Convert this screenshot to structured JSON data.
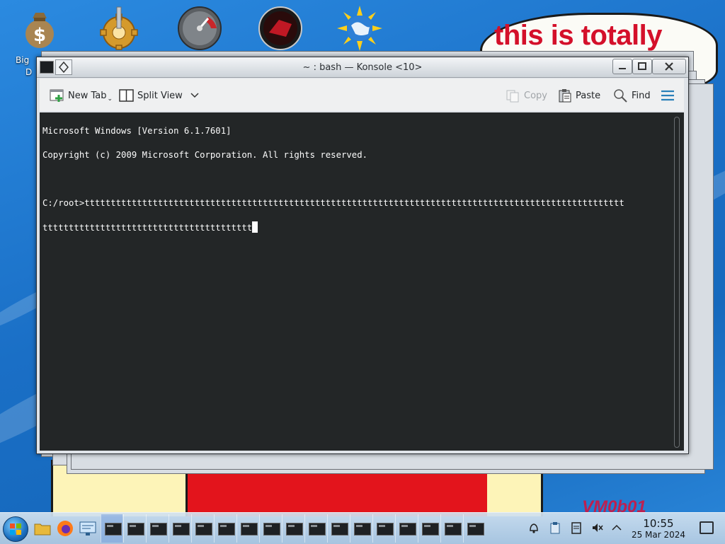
{
  "desktop": {
    "icon_label_line1": "Big",
    "icon_label_line2": "D",
    "banner_text": "this is totally",
    "watermark": "VM0b01"
  },
  "window": {
    "title": "~ : bash — Konsole <10>",
    "controls": {
      "minimize": "minimize",
      "maximize": "maximize",
      "close": "close"
    }
  },
  "toolbar": {
    "new_tab": "New Tab",
    "split_view": "Split View",
    "copy": "Copy",
    "paste": "Paste",
    "find": "Find"
  },
  "terminal": {
    "lines": [
      "Microsoft Windows [Version 6.1.7601]",
      "Copyright (c) 2009 Microsoft Corporation. All rights reserved.",
      "",
      "C:/root>ttttttttttttttttttttttttttttttttttttttttttttttttttttttttttttttttttttttttttttttttttttttttttttttttttttttt",
      "tttttttttttttttttttttttttttttttttttttttt"
    ]
  },
  "taskbar": {
    "time": "10:55",
    "date": "25 Mar 2024",
    "task_count": 17
  },
  "colors": {
    "terminal_bg": "#232627",
    "terminal_fg": "#fcfcfc",
    "accent": "#3daee9",
    "banner_red": "#d4102a"
  }
}
